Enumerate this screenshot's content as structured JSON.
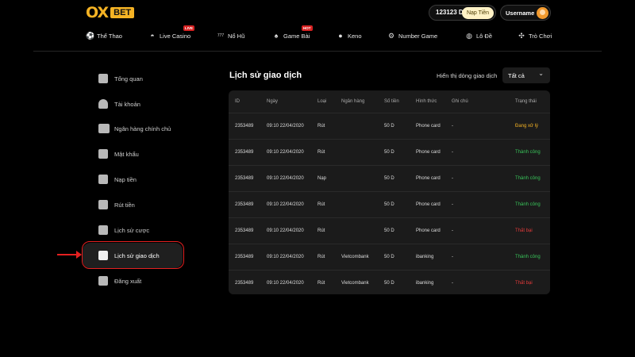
{
  "header": {
    "logo_ox": "OX",
    "logo_bet": "BET",
    "balance": "123123 D",
    "deposit_label": "Nạp Tiền",
    "username": "Username"
  },
  "nav": {
    "items": [
      {
        "label": "Thể Thao",
        "icon": "soccer-ball-icon"
      },
      {
        "label": "Live Casino",
        "icon": "mask-icon",
        "badge": "LIVE"
      },
      {
        "label": "Nổ Hũ",
        "icon": "slot-777-icon"
      },
      {
        "label": "Game Bài",
        "icon": "spade-icon",
        "badge": "HOT"
      },
      {
        "label": "Keno",
        "icon": "keno-ball-icon"
      },
      {
        "label": "Number Game",
        "icon": "gear-icon"
      },
      {
        "label": "Lô Đề",
        "icon": "lottery-icon"
      },
      {
        "label": "Trò Chơi",
        "icon": "gamepad-icon"
      }
    ]
  },
  "sidebar": {
    "items": [
      {
        "label": "Tổng quan",
        "icon": "wallet-icon"
      },
      {
        "label": "Tài khoản",
        "icon": "user-icon"
      },
      {
        "label": "Ngân hàng chính chủ",
        "icon": "bank-icon"
      },
      {
        "label": "Mật khẩu",
        "icon": "lock-icon"
      },
      {
        "label": "Nạp tiền",
        "icon": "deposit-icon"
      },
      {
        "label": "Rút tiền",
        "icon": "withdraw-icon"
      },
      {
        "label": "Lịch sử cược",
        "icon": "bet-history-icon"
      },
      {
        "label": "Lịch sử giao dịch",
        "icon": "transaction-history-icon",
        "active": true
      },
      {
        "label": "Đăng xuất",
        "icon": "logout-icon"
      }
    ]
  },
  "main": {
    "title": "Lịch sử giao dịch",
    "filter_label": "Hiển thị dòng giao dịch",
    "filter_value": "Tất cả"
  },
  "table": {
    "headers": [
      "ID",
      "Ngày",
      "Loại",
      "Ngân hàng",
      "Số tiền",
      "Hình thức",
      "Ghi chú",
      "Trạng thái"
    ],
    "rows": [
      {
        "id": "2353489",
        "date": "09:10 22/04/2020",
        "type": "Rút",
        "bank": "",
        "amount": "50 D",
        "method": "Phone card",
        "note": "-",
        "status": "Đang xử lý",
        "status_kind": "processing"
      },
      {
        "id": "2353489",
        "date": "09:10 22/04/2020",
        "type": "Rút",
        "bank": "",
        "amount": "50 D",
        "method": "Phone card",
        "note": "-",
        "status": "Thành công",
        "status_kind": "success"
      },
      {
        "id": "2353489",
        "date": "09:10 22/04/2020",
        "type": "Nạp",
        "bank": "",
        "amount": "50 D",
        "method": "Phone card",
        "note": "-",
        "status": "Thành công",
        "status_kind": "success"
      },
      {
        "id": "2353489",
        "date": "09:10 22/04/2020",
        "type": "Rút",
        "bank": "",
        "amount": "50 D",
        "method": "Phone card",
        "note": "-",
        "status": "Thành công",
        "status_kind": "success"
      },
      {
        "id": "2353489",
        "date": "09:10 22/04/2020",
        "type": "Rút",
        "bank": "",
        "amount": "50 D",
        "method": "Phone card",
        "note": "-",
        "status": "Thất bại",
        "status_kind": "fail"
      },
      {
        "id": "2353489",
        "date": "09:10 22/04/2020",
        "type": "Rút",
        "bank": "Vietcombank",
        "amount": "50 D",
        "method": "ibanking",
        "note": "-",
        "status": "Thành công",
        "status_kind": "success"
      },
      {
        "id": "2353489",
        "date": "09:10 22/04/2020",
        "type": "Rút",
        "bank": "Vietcombank",
        "amount": "50 D",
        "method": "ibanking",
        "note": "-",
        "status": "Thất bại",
        "status_kind": "fail"
      }
    ]
  },
  "colors": {
    "accent": "#f5b324",
    "success": "#39c45a",
    "fail": "#e23a3a",
    "highlight": "#e42020"
  }
}
